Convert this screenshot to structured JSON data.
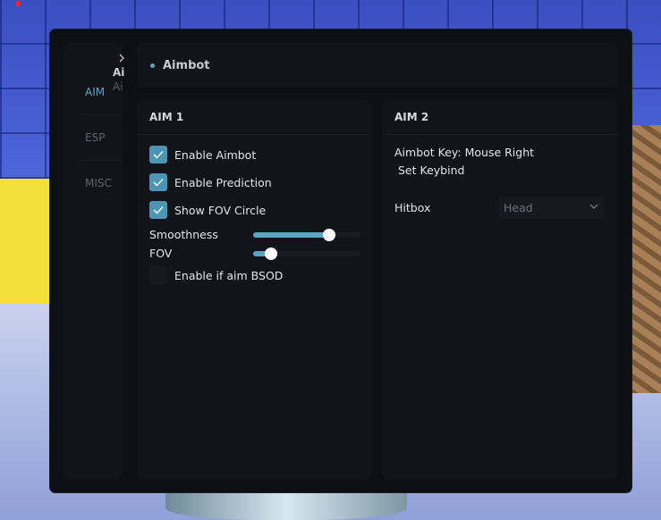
{
  "sidebar": {
    "items": [
      {
        "label": "AIM",
        "active": true
      },
      {
        "label": "ESP",
        "active": false
      },
      {
        "label": "MISC",
        "active": false
      }
    ],
    "peek_title": "Ai",
    "peek_subtitle": "Ai"
  },
  "header": {
    "title": "Aimbot"
  },
  "aim1": {
    "title": "AIM 1",
    "checkboxes": [
      {
        "label": "Enable Aimbot",
        "checked": true
      },
      {
        "label": "Enable Prediction",
        "checked": true
      },
      {
        "label": "Show FOV Circle",
        "checked": true
      }
    ],
    "sliders": [
      {
        "label": "Smoothness",
        "fraction": 0.71
      },
      {
        "label": "FOV",
        "fraction": 0.17
      }
    ],
    "bsod_checkbox": {
      "label": "Enable if aim BSOD",
      "checked": false
    }
  },
  "aim2": {
    "title": "AIM 2",
    "aimbot_key": "Aimbot Key: Mouse Right",
    "set_keybind_label": "Set Keybind",
    "hitbox_label": "Hitbox",
    "hitbox_value": "Head"
  },
  "colors": {
    "accent": "#5aa7c4",
    "checkbox_on": "#4e95b3",
    "window_bg": "#0d0f14",
    "panel_bg": "#121419"
  }
}
